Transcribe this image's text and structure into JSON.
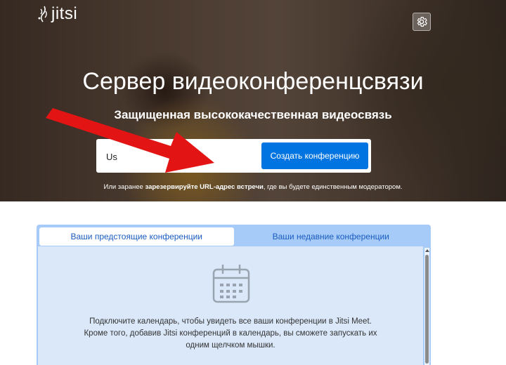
{
  "header": {
    "logo_text": "jitsi",
    "settings_icon": "gear-icon"
  },
  "hero": {
    "title": "Сервер видеоконференцсвязи",
    "subtitle": "Защищенная высококачественная видеосвязь",
    "room_input_value": "Us",
    "create_button_label": "Создать конференцию",
    "hint_prefix": "Или заранее ",
    "hint_link": "зарезервируйте URL-адрес встречи",
    "hint_suffix": ", где вы будете единственным модератором.",
    "accent_color": "#0074e0"
  },
  "panel": {
    "tabs": [
      {
        "label": "Ваши предстоящие конференции",
        "active": true
      },
      {
        "label": "Ваши недавние конференции",
        "active": false
      }
    ],
    "icon": "calendar-icon",
    "message": "Подключите календарь, чтобы увидеть все ваши конференции в Jitsi Meet. Кроме того, добавив Jitsi конференций в календарь, вы сможете запускать их одним щелчком мышки."
  }
}
